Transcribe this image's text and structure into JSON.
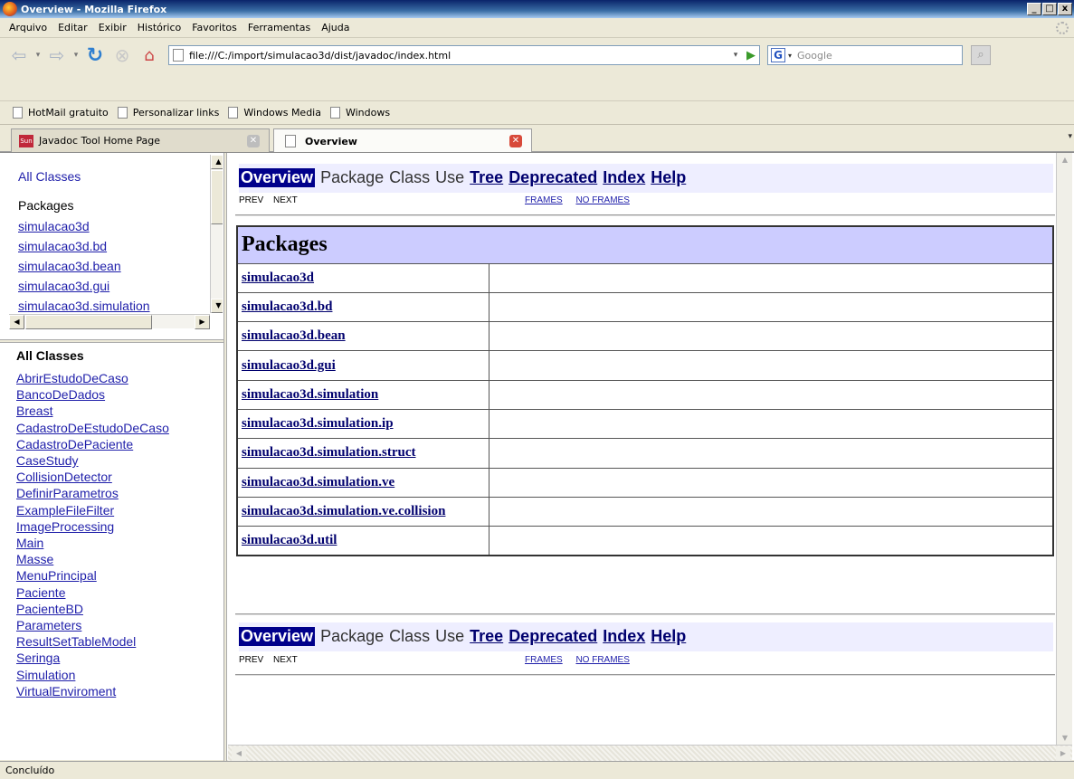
{
  "window": {
    "title": "Overview - Mozilla Firefox",
    "buttons": [
      "_",
      "□",
      "x"
    ]
  },
  "menu": [
    "Arquivo",
    "Editar",
    "Exibir",
    "Histórico",
    "Favoritos",
    "Ferramentas",
    "Ajuda"
  ],
  "nav": {
    "url": "file:///C:/import/simulacao3d/dist/javadoc/index.html",
    "search_placeholder": "Google"
  },
  "bookmarks": [
    "HotMail gratuito",
    "Personalizar links",
    "Windows Media",
    "Windows"
  ],
  "tabs": [
    {
      "label": "Javadoc Tool Home Page",
      "icon": "sun-icon",
      "active": false
    },
    {
      "label": "Overview",
      "icon": "page-icon",
      "active": true
    }
  ],
  "package_frame": {
    "all_classes": "All Classes",
    "packages_header": "Packages",
    "packages": [
      "simulacao3d",
      "simulacao3d.bd",
      "simulacao3d.bean",
      "simulacao3d.gui",
      "simulacao3d.simulation"
    ]
  },
  "class_frame": {
    "header": "All Classes",
    "classes": [
      "AbrirEstudoDeCaso",
      "BancoDeDados",
      "Breast",
      "CadastroDeEstudoDeCaso",
      "CadastroDePaciente",
      "CaseStudy",
      "CollisionDetector",
      "DefinirParametros",
      "ExampleFileFilter",
      "ImageProcessing",
      "Main",
      "Masse",
      "MenuPrincipal",
      "Paciente",
      "PacienteBD",
      "Parameters",
      "ResultSetTableModel",
      "Seringa",
      "Simulation",
      "VirtualEnviroment"
    ]
  },
  "doc_nav": {
    "overview": "Overview",
    "package": "Package",
    "class": "Class",
    "use": "Use",
    "tree": "Tree",
    "deprecated": "Deprecated",
    "index": "Index",
    "help": "Help",
    "prev": "PREV",
    "next": "NEXT",
    "frames": "FRAMES",
    "no_frames": "NO FRAMES"
  },
  "packages_table": {
    "header": "Packages",
    "rows": [
      "simulacao3d",
      "simulacao3d.bd",
      "simulacao3d.bean",
      "simulacao3d.gui",
      "simulacao3d.simulation",
      "simulacao3d.simulation.ip",
      "simulacao3d.simulation.struct",
      "simulacao3d.simulation.ve",
      "simulacao3d.simulation.ve.collision",
      "simulacao3d.util"
    ]
  },
  "status": "Concluído",
  "colors": {
    "nav_active_bg": "#00008b",
    "nav_bar_bg": "#eeeeff",
    "table_header_bg": "#ccccff",
    "link": "#1f1faa"
  }
}
